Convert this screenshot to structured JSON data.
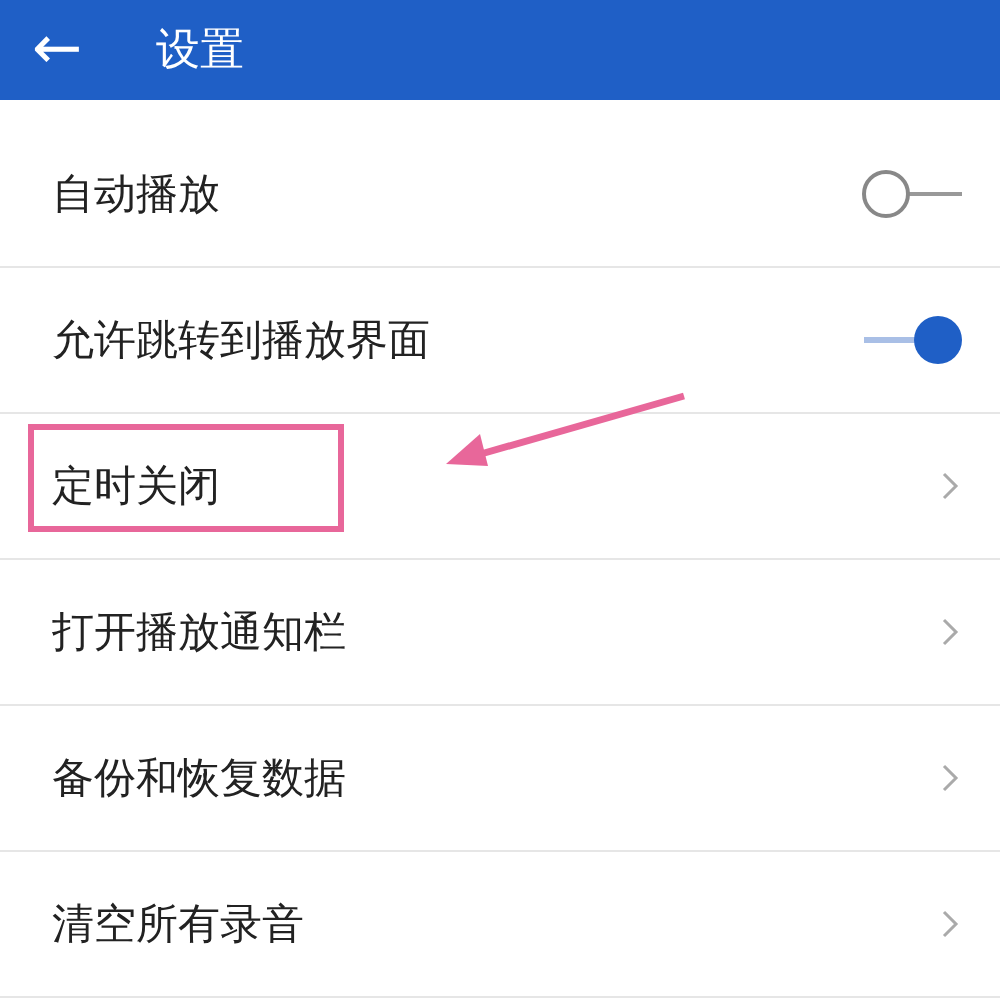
{
  "header": {
    "back": "←",
    "title": "设置"
  },
  "items": [
    {
      "label": "自动播放",
      "kind": "toggle",
      "on": false,
      "highlighted": false
    },
    {
      "label": "允许跳转到播放界面",
      "kind": "toggle",
      "on": true,
      "highlighted": false
    },
    {
      "label": "定时关闭",
      "kind": "link",
      "highlighted": true
    },
    {
      "label": "打开播放通知栏",
      "kind": "link",
      "highlighted": false
    },
    {
      "label": "备份和恢复数据",
      "kind": "link",
      "highlighted": false
    },
    {
      "label": "清空所有录音",
      "kind": "link",
      "highlighted": false
    }
  ]
}
